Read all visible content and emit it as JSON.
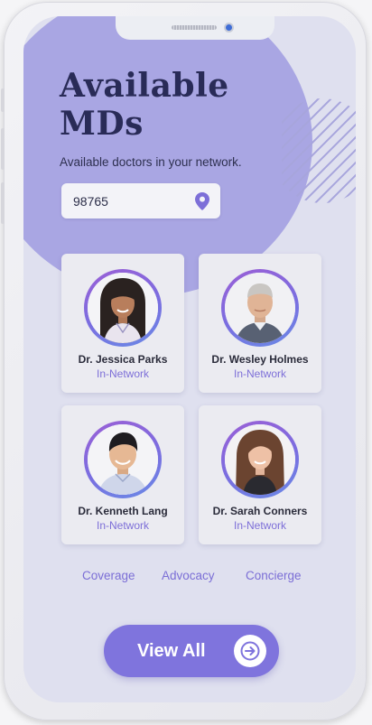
{
  "header": {
    "title_line1": "Available",
    "title_line2": "MDs",
    "subtitle": "Available doctors in your network."
  },
  "search": {
    "zip_value": "98765",
    "location_icon": "map-pin-icon"
  },
  "doctors": [
    {
      "name": "Dr. Jessica Parks",
      "status": "In-Network",
      "avatar": "female-doctor-photo"
    },
    {
      "name": "Dr. Wesley Holmes",
      "status": "In-Network",
      "avatar": "male-doctor-photo"
    },
    {
      "name": "Dr. Kenneth Lang",
      "status": "In-Network",
      "avatar": "male-doctor-photo"
    },
    {
      "name": "Dr. Sarah Conners",
      "status": "In-Network",
      "avatar": "female-doctor-photo"
    }
  ],
  "links": {
    "coverage": "Coverage",
    "advocacy": "Advocacy",
    "concierge": "Concierge"
  },
  "cta": {
    "label": "View All",
    "icon": "arrow-right-circle-icon"
  },
  "colors": {
    "accent": "#7f74dd",
    "blob": "#a9a6e3",
    "title": "#292b57",
    "status": "#7d6fd8",
    "background": "#dfe0ef"
  }
}
